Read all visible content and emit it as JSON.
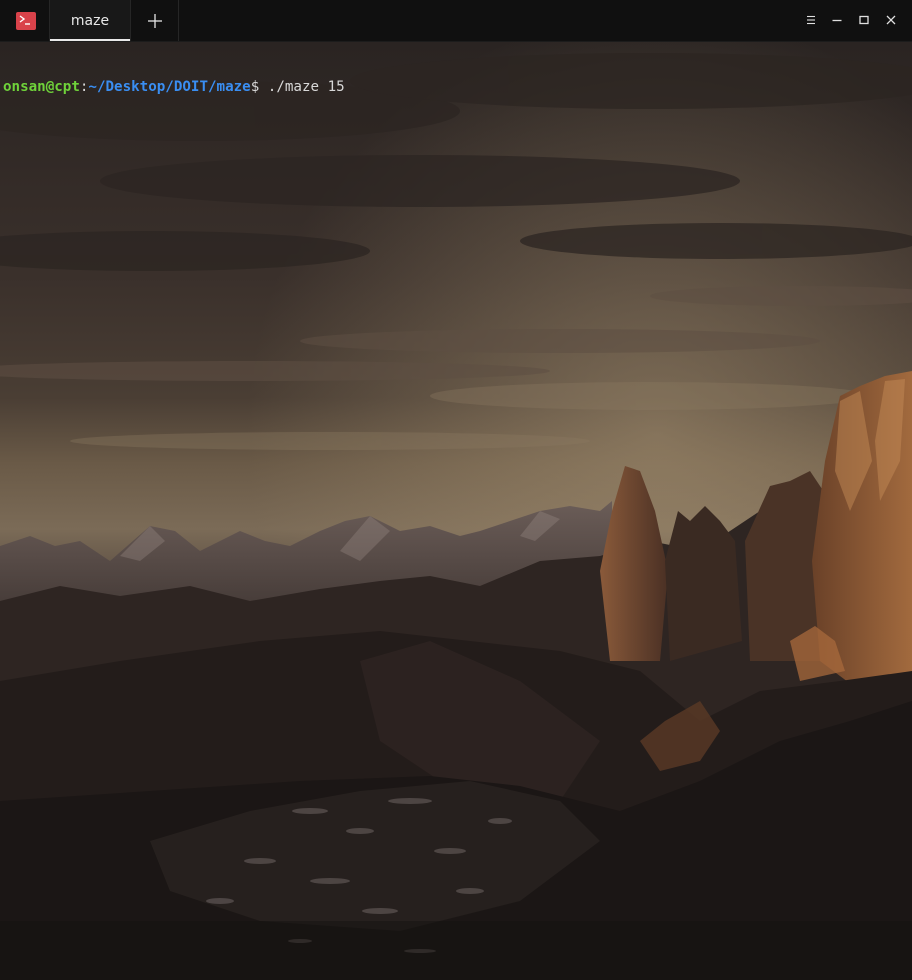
{
  "window": {
    "tab_title": "maze",
    "new_tab_icon": "plus-icon",
    "app_icon": "terminal-icon",
    "controls": [
      "menu-icon",
      "minimize-icon",
      "maximize-icon",
      "close-icon"
    ],
    "accent_color": "#d9424a"
  },
  "terminal": {
    "prompt_user_host": "onsan@cpt",
    "prompt_colon": ":",
    "prompt_path": "~/Desktop/DOIT/maze",
    "prompt_symbol": "$",
    "command": " ./maze 15",
    "colors": {
      "user_host": "#6fd23a",
      "path": "#3a8ef2",
      "text": "#d8d8d8"
    }
  }
}
